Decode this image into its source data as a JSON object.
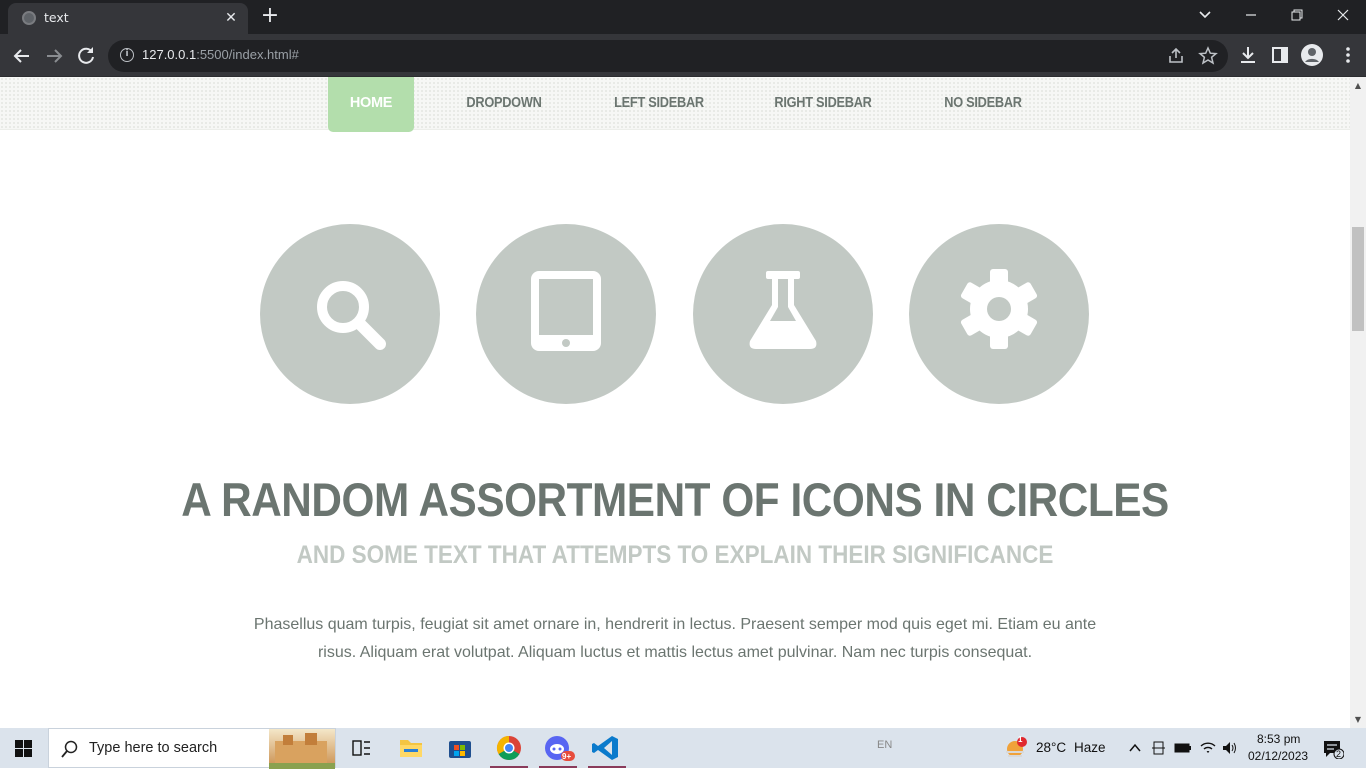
{
  "browser": {
    "tab_title": "text",
    "url_host": "127.0.0.1",
    "url_rest": ":5500/index.html#"
  },
  "nav": {
    "items": [
      "HOME",
      "DROPDOWN",
      "LEFT SIDEBAR",
      "RIGHT SIDEBAR",
      "NO SIDEBAR"
    ],
    "active": "HOME"
  },
  "icons": [
    "search-icon",
    "tablet-icon",
    "flask-icon",
    "gear-icon"
  ],
  "content": {
    "headline": "A RANDOM ASSORTMENT OF ICONS IN CIRCLES",
    "subheadline": "AND SOME TEXT THAT ATTEMPTS TO EXPLAIN THEIR SIGNIFICANCE",
    "body": "Phasellus quam turpis, feugiat sit amet ornare in, hendrerit in lectus. Praesent semper mod quis eget mi. Etiam eu ante risus. Aliquam erat volutpat. Aliquam luctus et mattis lectus amet pulvinar. Nam nec turpis consequat."
  },
  "taskbar": {
    "search_placeholder": "Type here to search",
    "language": "EN",
    "weather_temp": "28°C",
    "weather_desc": "Haze",
    "weather_badge": "1",
    "time": "8:53 pm",
    "date": "02/12/2023",
    "notification_count": "2",
    "discord_badge": "9+"
  },
  "colors": {
    "accent_green": "#b3deac",
    "circle_gray": "#c2c9c4",
    "text_gray": "#6b7570"
  }
}
